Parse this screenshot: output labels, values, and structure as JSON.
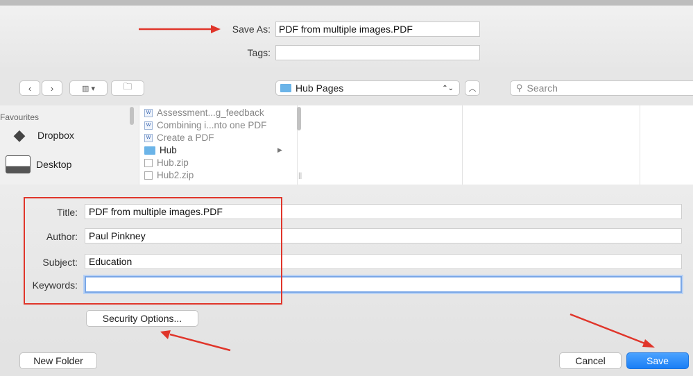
{
  "header": {
    "save_as_label": "Save As:",
    "save_as_value": "PDF from multiple images.PDF",
    "tags_label": "Tags:",
    "tags_value": ""
  },
  "toolbar": {
    "back_icon": "chevron-left-icon",
    "forward_icon": "chevron-right-icon",
    "view_icon": "column-view-icon",
    "new_folder_icon": "new-folder-icon",
    "location": "Hub Pages",
    "search_placeholder": "Search"
  },
  "sidebar": {
    "section": "Favourites",
    "items": [
      {
        "label": "Dropbox",
        "icon": "dropbox-icon"
      },
      {
        "label": "Desktop",
        "icon": "desktop-icon"
      }
    ]
  },
  "files": [
    {
      "name": "Assessment...g_feedback",
      "type": "doc"
    },
    {
      "name": "Combining i...nto one PDF",
      "type": "doc"
    },
    {
      "name": "Create a PDF",
      "type": "doc"
    },
    {
      "name": "Hub",
      "type": "folder"
    },
    {
      "name": "Hub.zip",
      "type": "zip"
    },
    {
      "name": "Hub2.zip",
      "type": "zip"
    }
  ],
  "form": {
    "title_label": "Title:",
    "title_value": "PDF from multiple images.PDF",
    "author_label": "Author:",
    "author_value": "Paul Pinkney",
    "subject_label": "Subject:",
    "subject_value": "Education",
    "keywords_label": "Keywords:",
    "keywords_value": "",
    "security_button": "Security Options..."
  },
  "footer": {
    "new_folder": "New Folder",
    "cancel": "Cancel",
    "save": "Save"
  },
  "colors": {
    "accent": "#1b7ff5",
    "annotation": "#e0352a",
    "folder": "#6bb4e8"
  }
}
